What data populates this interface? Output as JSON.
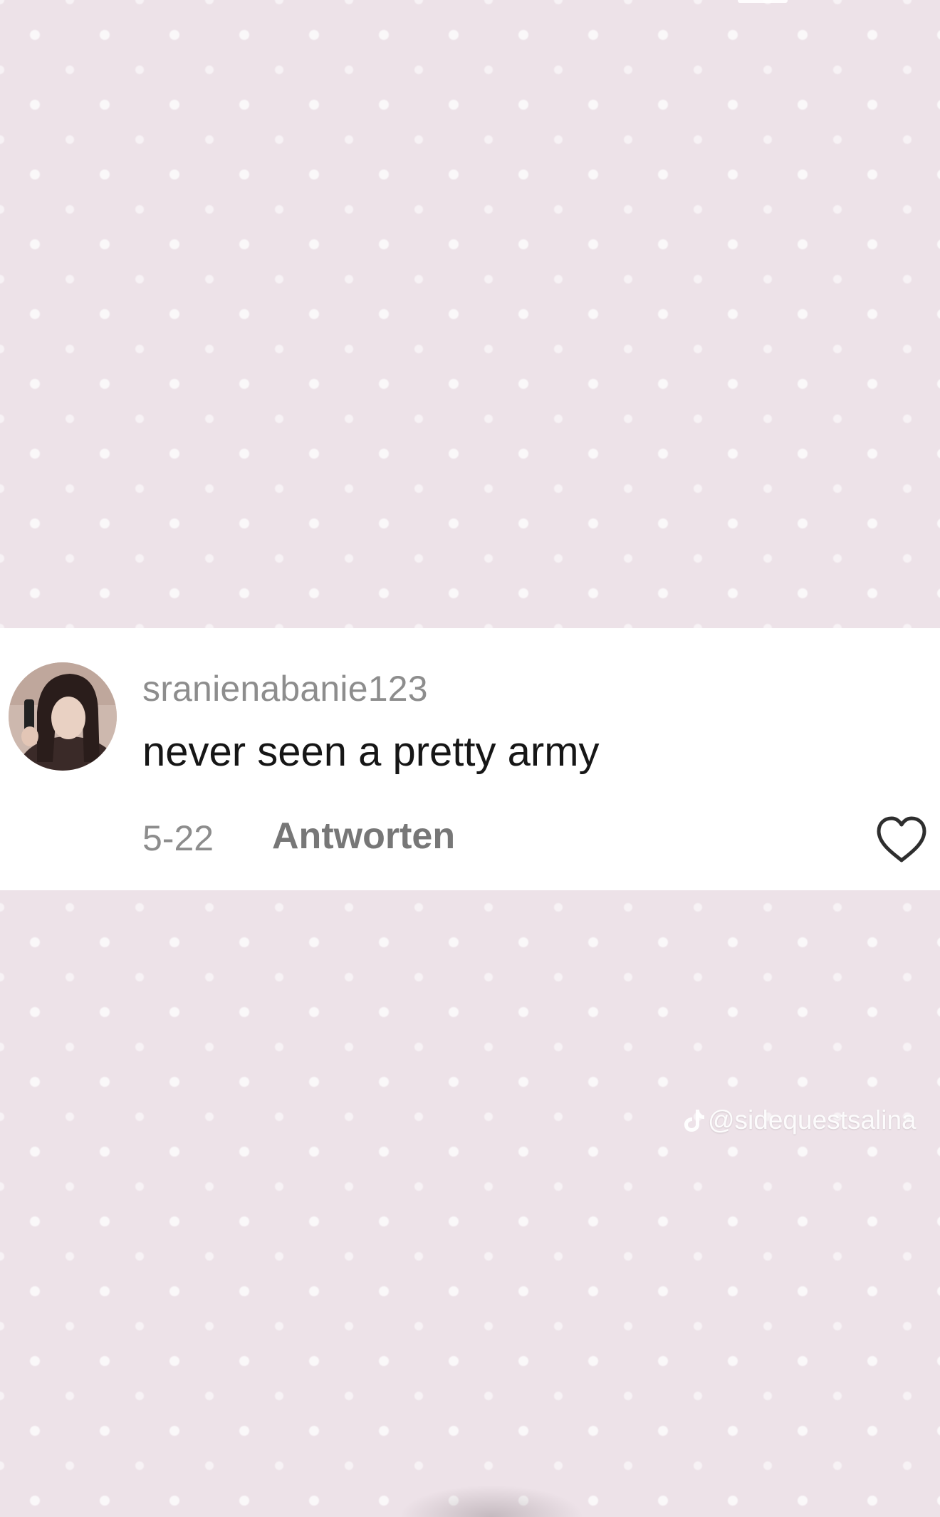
{
  "comment": {
    "username": "sranienabanie123",
    "text": "never seen a pretty army",
    "date": "5-22",
    "reply_label": "Antworten",
    "avatar_icon": "user-avatar-photo",
    "like_icon": "heart-outline-icon"
  },
  "watermark": {
    "icon": "tiktok-logo-icon",
    "handle": "@sidequestsalina"
  },
  "colors": {
    "background": "#ede2e8",
    "card": "#ffffff",
    "username": "#8d8d8d",
    "comment_text": "#161616",
    "reply": "#777777"
  }
}
